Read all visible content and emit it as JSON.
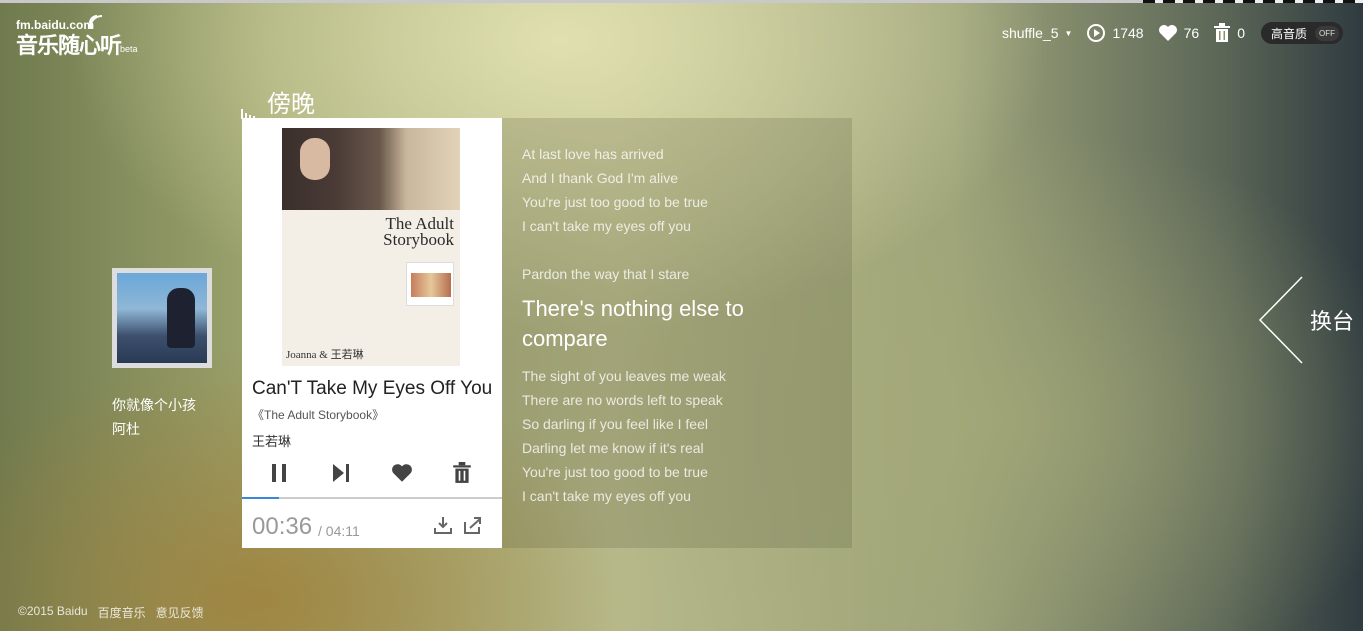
{
  "logo": {
    "domain": "fm.baidu.com",
    "name": "音乐随心听",
    "tag": "beta"
  },
  "topbar": {
    "username": "shuffle_5",
    "played_count": "1748",
    "liked_count": "76",
    "trash_count": "0",
    "hq_label": "高音质",
    "hq_state": "OFF"
  },
  "channel": {
    "title": "傍晚"
  },
  "previous": {
    "song": "你就像个小孩",
    "artist": "阿杜"
  },
  "now_playing": {
    "title": "Can'T Take My Eyes Off You",
    "album": "《The Adult Storybook》",
    "artist": "王若琳",
    "cover_title": "The Adult Storybook",
    "cover_artist": "Joanna & 王若琳",
    "elapsed": "00:36",
    "duration": "/ 04:11",
    "progress": 0.143
  },
  "lyrics": {
    "before": [
      "At last love has arrived",
      "And I thank God I'm alive",
      "You're just too good to be true",
      "I can't take my eyes off you"
    ],
    "before_current": "Pardon the way that I stare",
    "current": "There's nothing else to compare",
    "after": [
      "The sight of you leaves me weak",
      "There are no words left to speak",
      "So darling if you feel like I feel",
      "Darling let me know if it's real",
      "You're just too good to be true",
      "I can't take my eyes off you"
    ]
  },
  "switch_channel": {
    "label": "换台"
  },
  "footer": {
    "copyright": "©2015 Baidu",
    "link1": "百度音乐",
    "link2": "意见反馈"
  },
  "colors": {
    "accent": "#3a86d9"
  }
}
